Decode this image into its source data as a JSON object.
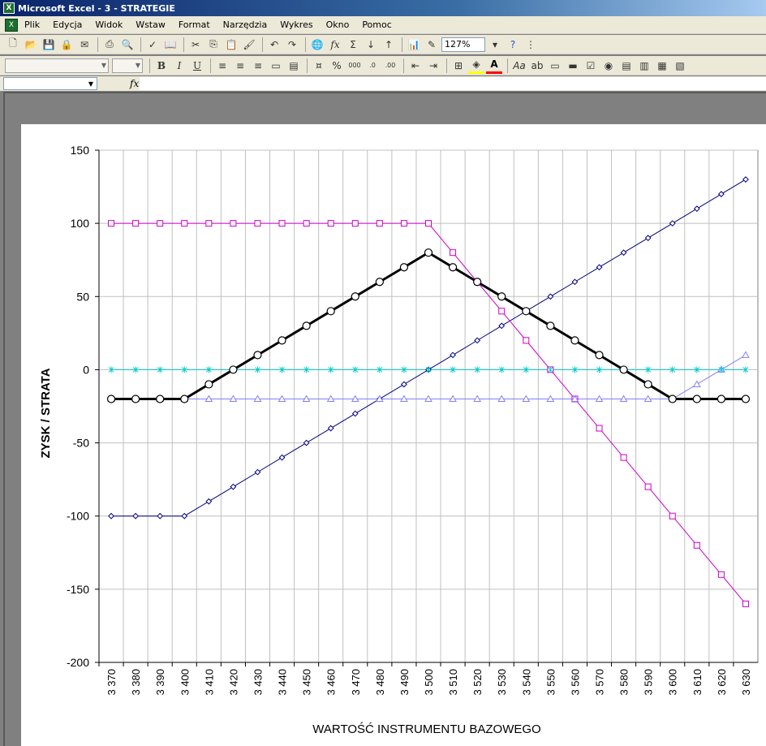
{
  "window": {
    "title": "Microsoft Excel - 3 - STRATEGIE"
  },
  "menu": [
    "Plik",
    "Edycja",
    "Widok",
    "Wstaw",
    "Format",
    "Narzędzia",
    "Wykres",
    "Okno",
    "Pomoc"
  ],
  "toolbar": {
    "zoom": "127%",
    "fx": "fx"
  },
  "colors": {
    "black_series": "#000000",
    "navy_series": "#000080",
    "magenta_series": "#cc00cc",
    "lightblue_series": "#8080ff",
    "cyan_series": "#00cccc"
  },
  "chart_data": {
    "type": "line",
    "xlabel": "WARTOŚĆ INSTRUMENTU BAZOWEGO",
    "ylabel": "ZYSK / STRATA",
    "ylim": [
      -200,
      150
    ],
    "yticks": [
      "150",
      "100",
      "50",
      "0",
      "-50",
      "-100",
      "-150",
      "-200"
    ],
    "categories": [
      "3 370",
      "3 380",
      "3 390",
      "3 400",
      "3 410",
      "3 420",
      "3 430",
      "3 440",
      "3 450",
      "3 460",
      "3 470",
      "3 480",
      "3 490",
      "3 500",
      "3 510",
      "3 520",
      "3 530",
      "3 540",
      "3 550",
      "3 560",
      "3 570",
      "3 580",
      "3 590",
      "3 600",
      "3 610",
      "3 620",
      "3 630"
    ],
    "grid": true,
    "series": [
      {
        "color": "#000080",
        "marker": "diamond",
        "values": [
          -100,
          -100,
          -100,
          -100,
          -90,
          -80,
          -70,
          -60,
          -50,
          -40,
          -30,
          -20,
          -10,
          0,
          10,
          20,
          30,
          40,
          50,
          60,
          70,
          80,
          90,
          100,
          110,
          120,
          130
        ]
      },
      {
        "color": "#cc00cc",
        "marker": "square",
        "values": [
          100,
          100,
          100,
          100,
          100,
          100,
          100,
          100,
          100,
          100,
          100,
          100,
          100,
          100,
          80,
          60,
          40,
          20,
          0,
          -20,
          -40,
          -60,
          -80,
          -100,
          -120,
          -140,
          -160
        ]
      },
      {
        "color": "#8080ff",
        "marker": "triangle",
        "values": [
          -20,
          -20,
          -20,
          -20,
          -20,
          -20,
          -20,
          -20,
          -20,
          -20,
          -20,
          -20,
          -20,
          -20,
          -20,
          -20,
          -20,
          -20,
          -20,
          -20,
          -20,
          -20,
          -20,
          -20,
          -10,
          0,
          10
        ]
      },
      {
        "color": "#00cccc",
        "marker": "star",
        "values": [
          0,
          0,
          0,
          0,
          0,
          0,
          0,
          0,
          0,
          0,
          0,
          0,
          0,
          0,
          0,
          0,
          0,
          0,
          0,
          0,
          0,
          0,
          0,
          0,
          0,
          0,
          0
        ]
      },
      {
        "color": "#000000",
        "marker": "circle",
        "bold": true,
        "values": [
          -20,
          -20,
          -20,
          -20,
          -10,
          0,
          10,
          20,
          30,
          40,
          50,
          60,
          70,
          80,
          70,
          60,
          50,
          40,
          30,
          20,
          10,
          0,
          -10,
          -20,
          -20,
          -20,
          -20
        ]
      }
    ]
  }
}
